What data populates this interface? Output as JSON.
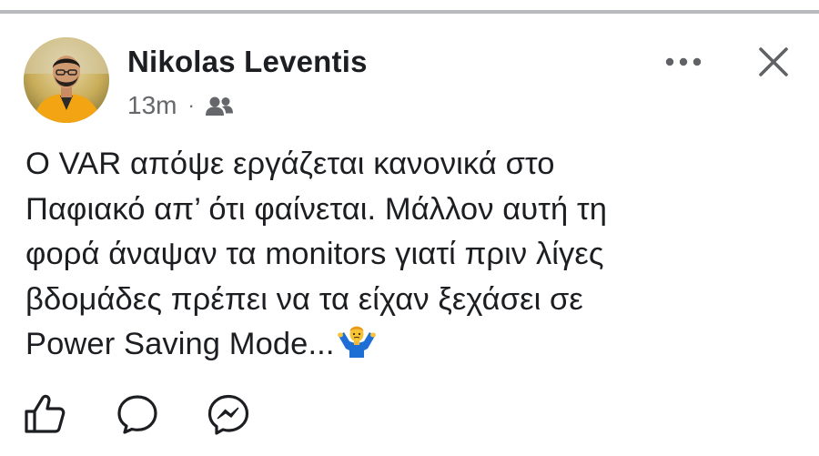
{
  "post": {
    "author": {
      "name": "Nikolas Leventis",
      "avatar_icon": "profile-photo"
    },
    "meta": {
      "timestamp": "13m",
      "separator": "·",
      "audience_icon": "friends-icon"
    },
    "text": "Ο VAR απόψε εργάζεται κανονικά στο\nΠαφιακό απ’ ότι φαίνεται. Μάλλον αυτή τη\nφορά άναψαν τα monitors γιατί πριν λίγες\nβδομάδες πρέπει να τα είχαν ξεχάσει σε\nPower Saving Mode...",
    "emoji": "man-shrugging-emoji",
    "header_actions": {
      "more_icon": "more-options-icon",
      "close_icon": "close-icon"
    },
    "actions": [
      {
        "icon": "like-icon"
      },
      {
        "icon": "comment-icon"
      },
      {
        "icon": "messenger-share-icon"
      }
    ],
    "colors": {
      "text": "#1c1e21",
      "secondary": "#65676b",
      "divider": "#b8babe"
    }
  }
}
